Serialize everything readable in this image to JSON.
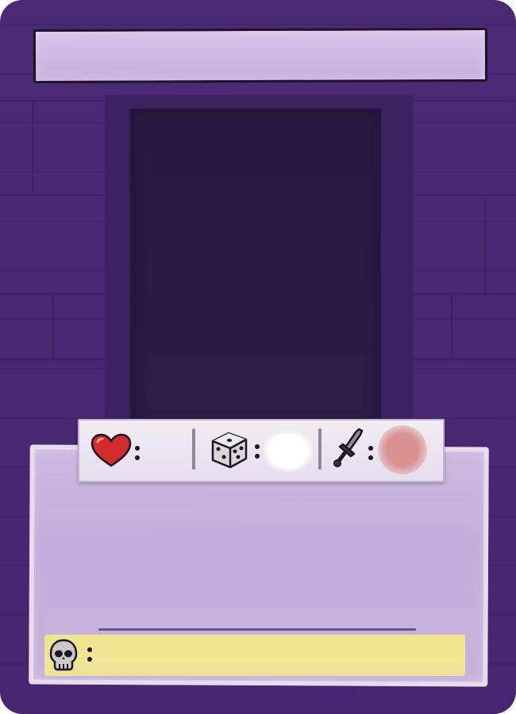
{
  "card": {
    "title": "",
    "description": "",
    "stats": {
      "health_icon": "heart-icon",
      "health_value": "",
      "roll_icon": "dice-icon",
      "roll_value": "",
      "attack_icon": "sword-icon",
      "attack_value": ""
    },
    "defeat": {
      "icon": "skull-icon",
      "text": ""
    }
  },
  "colors": {
    "card_background": "#4b2a75",
    "portal": "#2c1b44",
    "title_banner": "#cfb9e2",
    "text_panel": "#c8b2dd",
    "defeat_strip": "#efe390",
    "heart": "#d32a2a",
    "attack_smudge": "#d98e8e"
  }
}
